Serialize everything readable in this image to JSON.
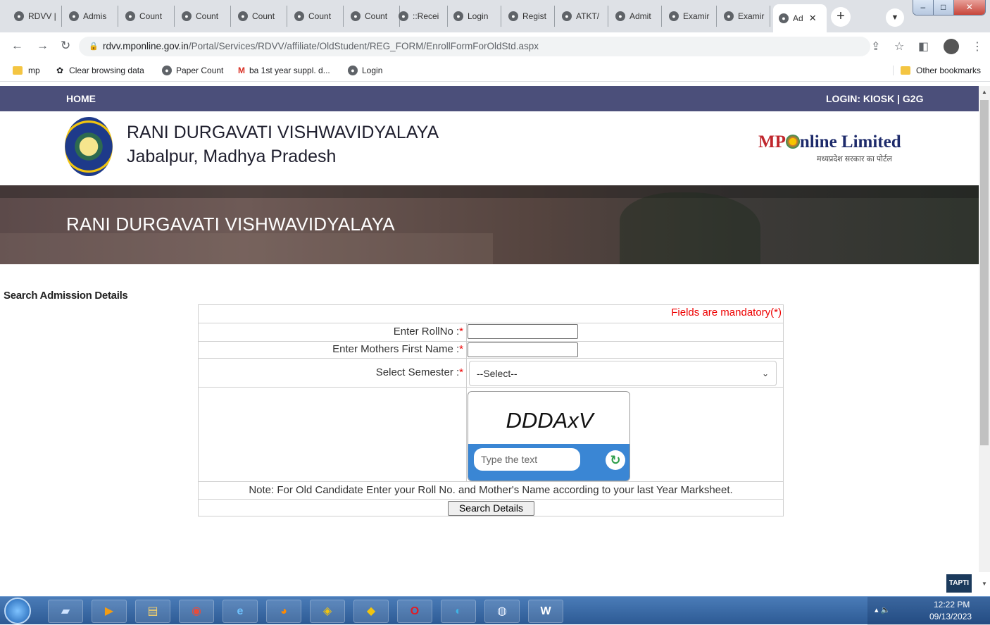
{
  "browser": {
    "tabs": [
      {
        "label": "RDVV |"
      },
      {
        "label": "Admis"
      },
      {
        "label": "Count"
      },
      {
        "label": "Count"
      },
      {
        "label": "Count"
      },
      {
        "label": "Count"
      },
      {
        "label": "Count"
      },
      {
        "label": "::Recei"
      },
      {
        "label": "Login"
      },
      {
        "label": "Regist"
      },
      {
        "label": "ATKT/"
      },
      {
        "label": "Admit"
      },
      {
        "label": "Examir"
      },
      {
        "label": "Examir"
      },
      {
        "label": "Ad"
      }
    ],
    "new_tab_glyph": "+",
    "url_host": "rdvv.mponline.gov.in",
    "url_path": "/Portal/Services/RDVV/affiliate/OldStudent/REG_FORM/EnrollFormForOldStd.aspx",
    "bookmarks": [
      {
        "label": "mp"
      },
      {
        "label": "Clear browsing data"
      },
      {
        "label": "Paper Count"
      },
      {
        "label": "ba 1st year suppl. d..."
      },
      {
        "label": "Login"
      }
    ],
    "other_bookmarks": "Other bookmarks"
  },
  "site": {
    "nav_home": "HOME",
    "nav_login": "LOGIN: KIOSK | G2G",
    "university_line1": "RANI DURGAVATI VISHWAVIDYALAYA",
    "university_line2": "Jabalpur, Madhya Pradesh",
    "mponline_brand_1": "MP",
    "mponline_brand_2": "nline Limited",
    "mponline_tagline": "मध्यप्रदेश सरकार का पोर्टल",
    "banner_title": "RANI DURGAVATI VISHWAVIDYALAYA"
  },
  "form": {
    "section_title": "Search Admission Details",
    "mandatory_note": "Fields are mandatory(*)",
    "rollno_label": "Enter RollNo :",
    "mothers_name_label": "Enter Mothers First Name :",
    "semester_label": "Select Semester :",
    "required_mark": "*",
    "semester_selected": "--Select--",
    "captcha_text": "DDDAxV",
    "captcha_placeholder": "Type the text",
    "note": "Note: For Old Candidate Enter your Roll No. and Mother's Name according to your last Year Marksheet.",
    "search_button": "Search Details"
  },
  "tapti_badge": "TAPTI",
  "taskbar": {
    "time": "12:22 PM",
    "date": "09/13/2023"
  },
  "colors": {
    "nav_bar": "#4b4f7a",
    "required_red": "#e00000",
    "captcha_bar": "#3a86d4"
  }
}
